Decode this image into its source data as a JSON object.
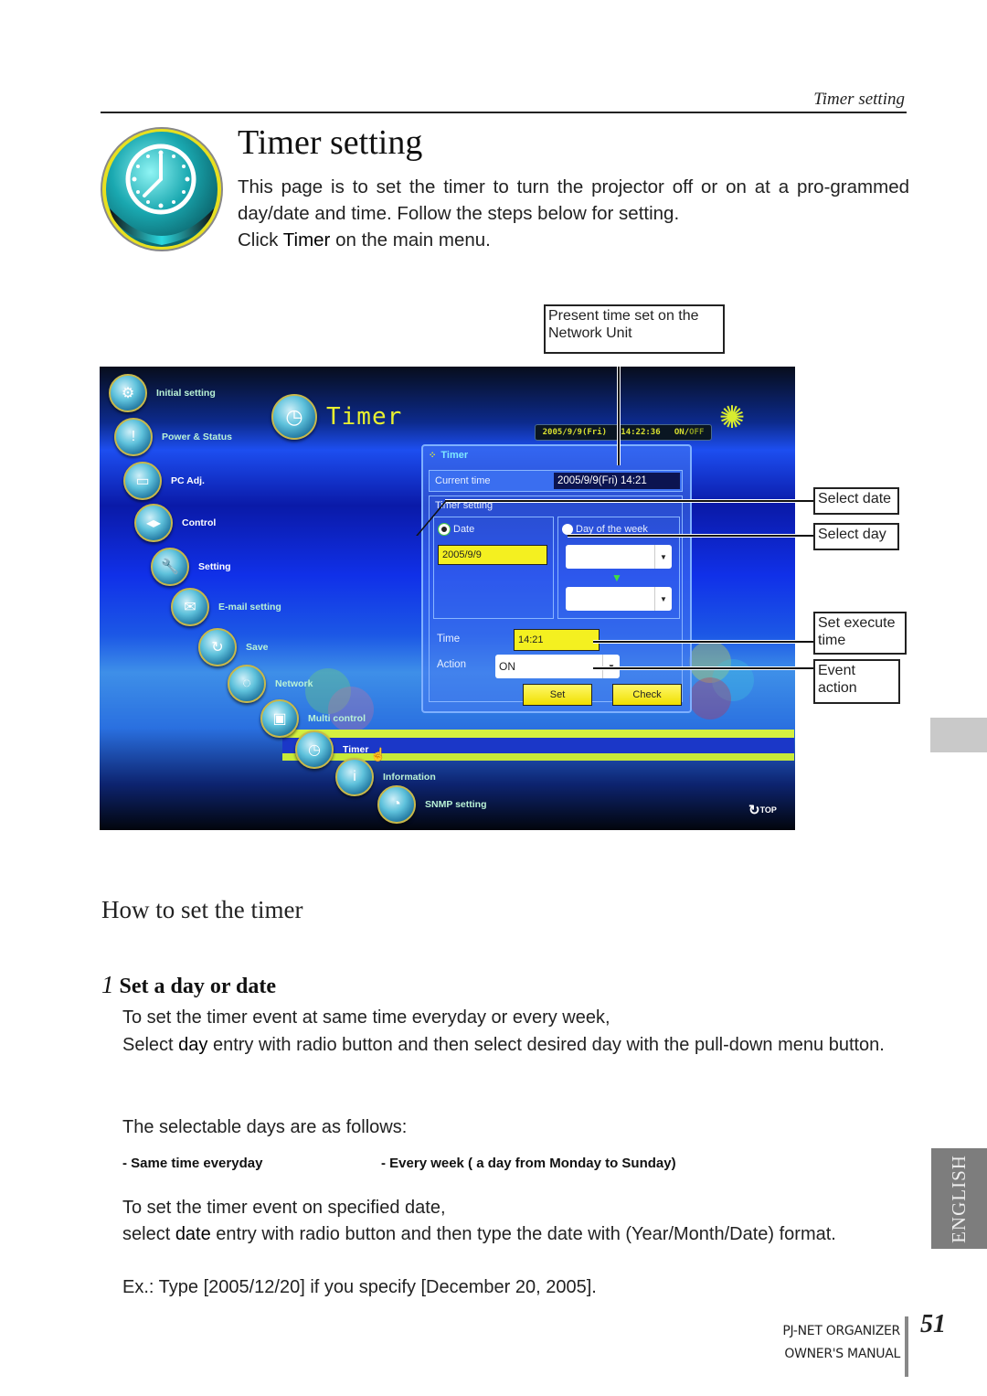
{
  "running_head": "Timer setting",
  "title": "Timer setting",
  "intro": {
    "line1": "This page is to set the timer to turn the projector off or on at a pro-grammed day/date and time. Follow the steps below for setting.",
    "click_prefix": "Click ",
    "click_bold": "Timer",
    "click_suffix": " on the main menu."
  },
  "icons": {
    "logo": "clock-icon",
    "top": "refresh-arrow-icon"
  },
  "screenshot": {
    "menu": [
      {
        "label": "Initial setting",
        "icon": "gear-projector-icon"
      },
      {
        "label": "Power & Status",
        "icon": "power-status-icon"
      },
      {
        "label": "PC Adj.",
        "icon": "monitor-icon"
      },
      {
        "label": "Control",
        "icon": "arrows-icon"
      },
      {
        "label": "Setting",
        "icon": "wrench-icon"
      },
      {
        "label": "E-mail setting",
        "icon": "envelope-icon"
      },
      {
        "label": "Save",
        "icon": "save-icon"
      },
      {
        "label": "Network",
        "icon": "network-icon"
      },
      {
        "label": "Multi control",
        "icon": "multi-control-icon"
      },
      {
        "label": "Timer",
        "icon": "clock-icon"
      },
      {
        "label": "Information",
        "icon": "info-icon"
      },
      {
        "label": "SNMP setting",
        "icon": "snmp-icon"
      }
    ],
    "page_heading": "Timer",
    "lcd": {
      "date": "2005/9/9(Fri)",
      "time": "14:22:36",
      "on": "ON/",
      "off": "OFF"
    },
    "panel": {
      "tab_label": "Timer",
      "current_time_label": "Current time",
      "current_time_value": "2005/9/9(Fri) 14:21",
      "timer_setting_label": "Timer setting",
      "date_radio_label": "Date",
      "day_radio_label": "Day of the week",
      "date_value": "2005/9/9",
      "day_select_value": "",
      "day_select2_value": "",
      "time_label": "Time",
      "time_value": "14:21",
      "action_label": "Action",
      "action_value": "ON",
      "set_button": "Set",
      "check_button": "Check"
    },
    "top_link": "TOP"
  },
  "callouts": {
    "present_time": "Present time set on the Network Unit",
    "select_date": "Select date",
    "select_day": "Select day",
    "set_execute_time": "Set execute time",
    "event_action": "Event action"
  },
  "section_heading": "How to set the timer",
  "step1": {
    "number": "1",
    "title": "Set a day or date",
    "p1": "To set the timer event at same time everyday or every week,",
    "p2_prefix": "Select ",
    "p2_bold": "day",
    "p2_suffix": " entry with radio button and then select desired day with the pull-down menu button.",
    "p3": "The selectable days are as follows:",
    "bullets": [
      "- Same time everyday",
      "- Every week ( a day from Monday to Sunday)"
    ],
    "p4": "To set the timer event on specified date,",
    "p5_prefix": "select ",
    "p5_bold": "date",
    "p5_suffix": " entry with radio button and then type the date with (Year/Month/Date) format.",
    "p6": "Ex.: Type [2005/12/20] if you specify [December 20, 2005]."
  },
  "side_tab": "ENGLISH",
  "footer": {
    "line1": "PJ-NET ORGANIZER",
    "line2": "OWNER'S MANUAL",
    "page": "51"
  }
}
